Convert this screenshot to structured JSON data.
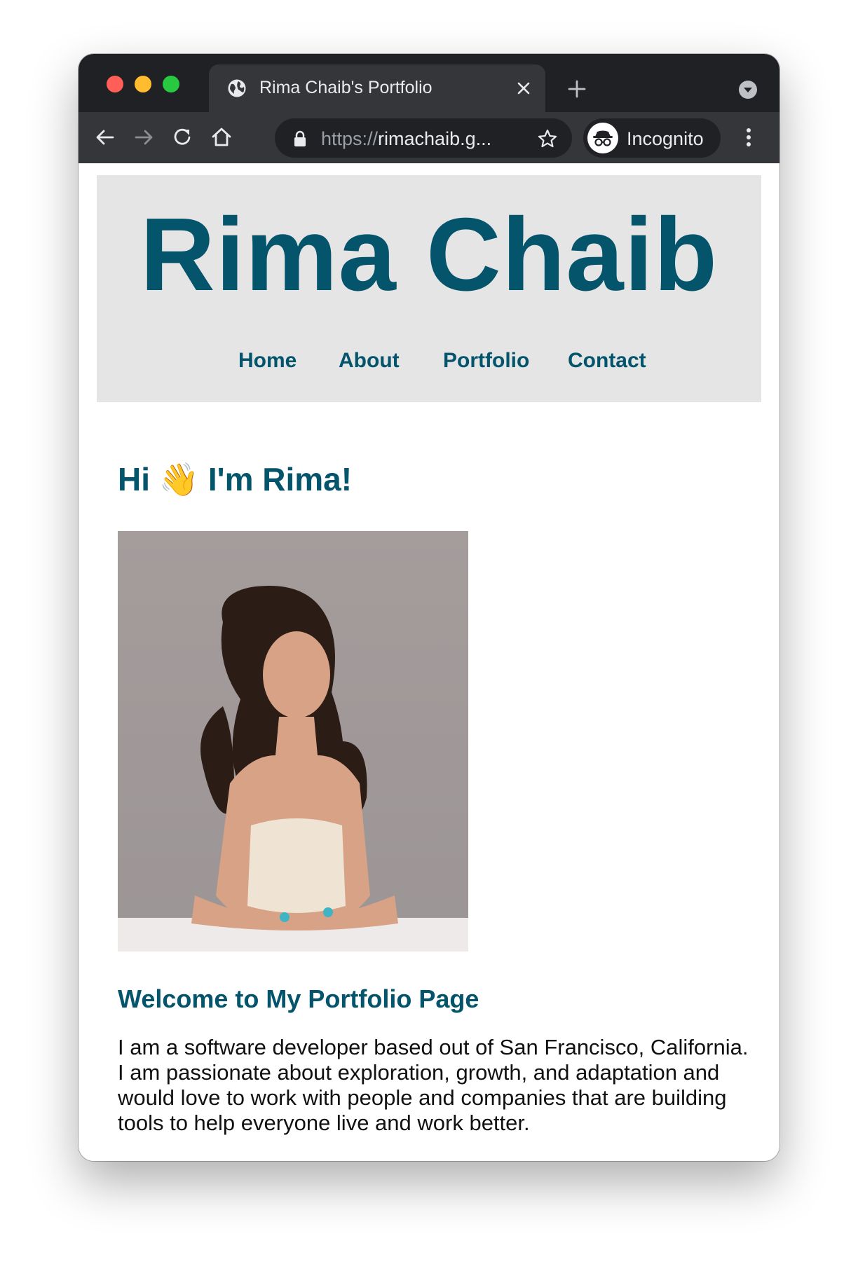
{
  "browser": {
    "tab_title": "Rima Chaib's Portfolio",
    "url_scheme": "https://",
    "url_rest": "rimachaib.g...",
    "profile_label": "Incognito"
  },
  "site": {
    "title": "Rima Chaib",
    "nav": [
      "Home",
      "About",
      "Portfolio",
      "Contact"
    ],
    "greeting_pre": "Hi",
    "greeting_emoji": "👋",
    "greeting_post": "I'm Rima!",
    "welcome_heading": "Welcome to My Portfolio Page",
    "bio": "I am a software developer based out of San Francisco, California. I am passionate about exploration, growth, and adaptation and would love to work with people and companies that are building tools to help everyone live and work better."
  },
  "icons": {
    "tab_favicon": "globe-icon",
    "tab_close": "close-icon",
    "new_tab": "plus-icon",
    "tab_search": "chevron-down-icon",
    "back": "back-arrow-icon",
    "forward": "forward-arrow-icon",
    "reload": "reload-icon",
    "home": "home-icon",
    "lock": "lock-icon",
    "bookmark": "star-icon",
    "incognito": "incognito-icon",
    "menu": "kebab-menu-icon"
  },
  "colors": {
    "brand": "#04546c",
    "header_bg": "#e5e5e5",
    "chrome_dark": "#202124",
    "chrome_toolbar": "#35363a"
  }
}
